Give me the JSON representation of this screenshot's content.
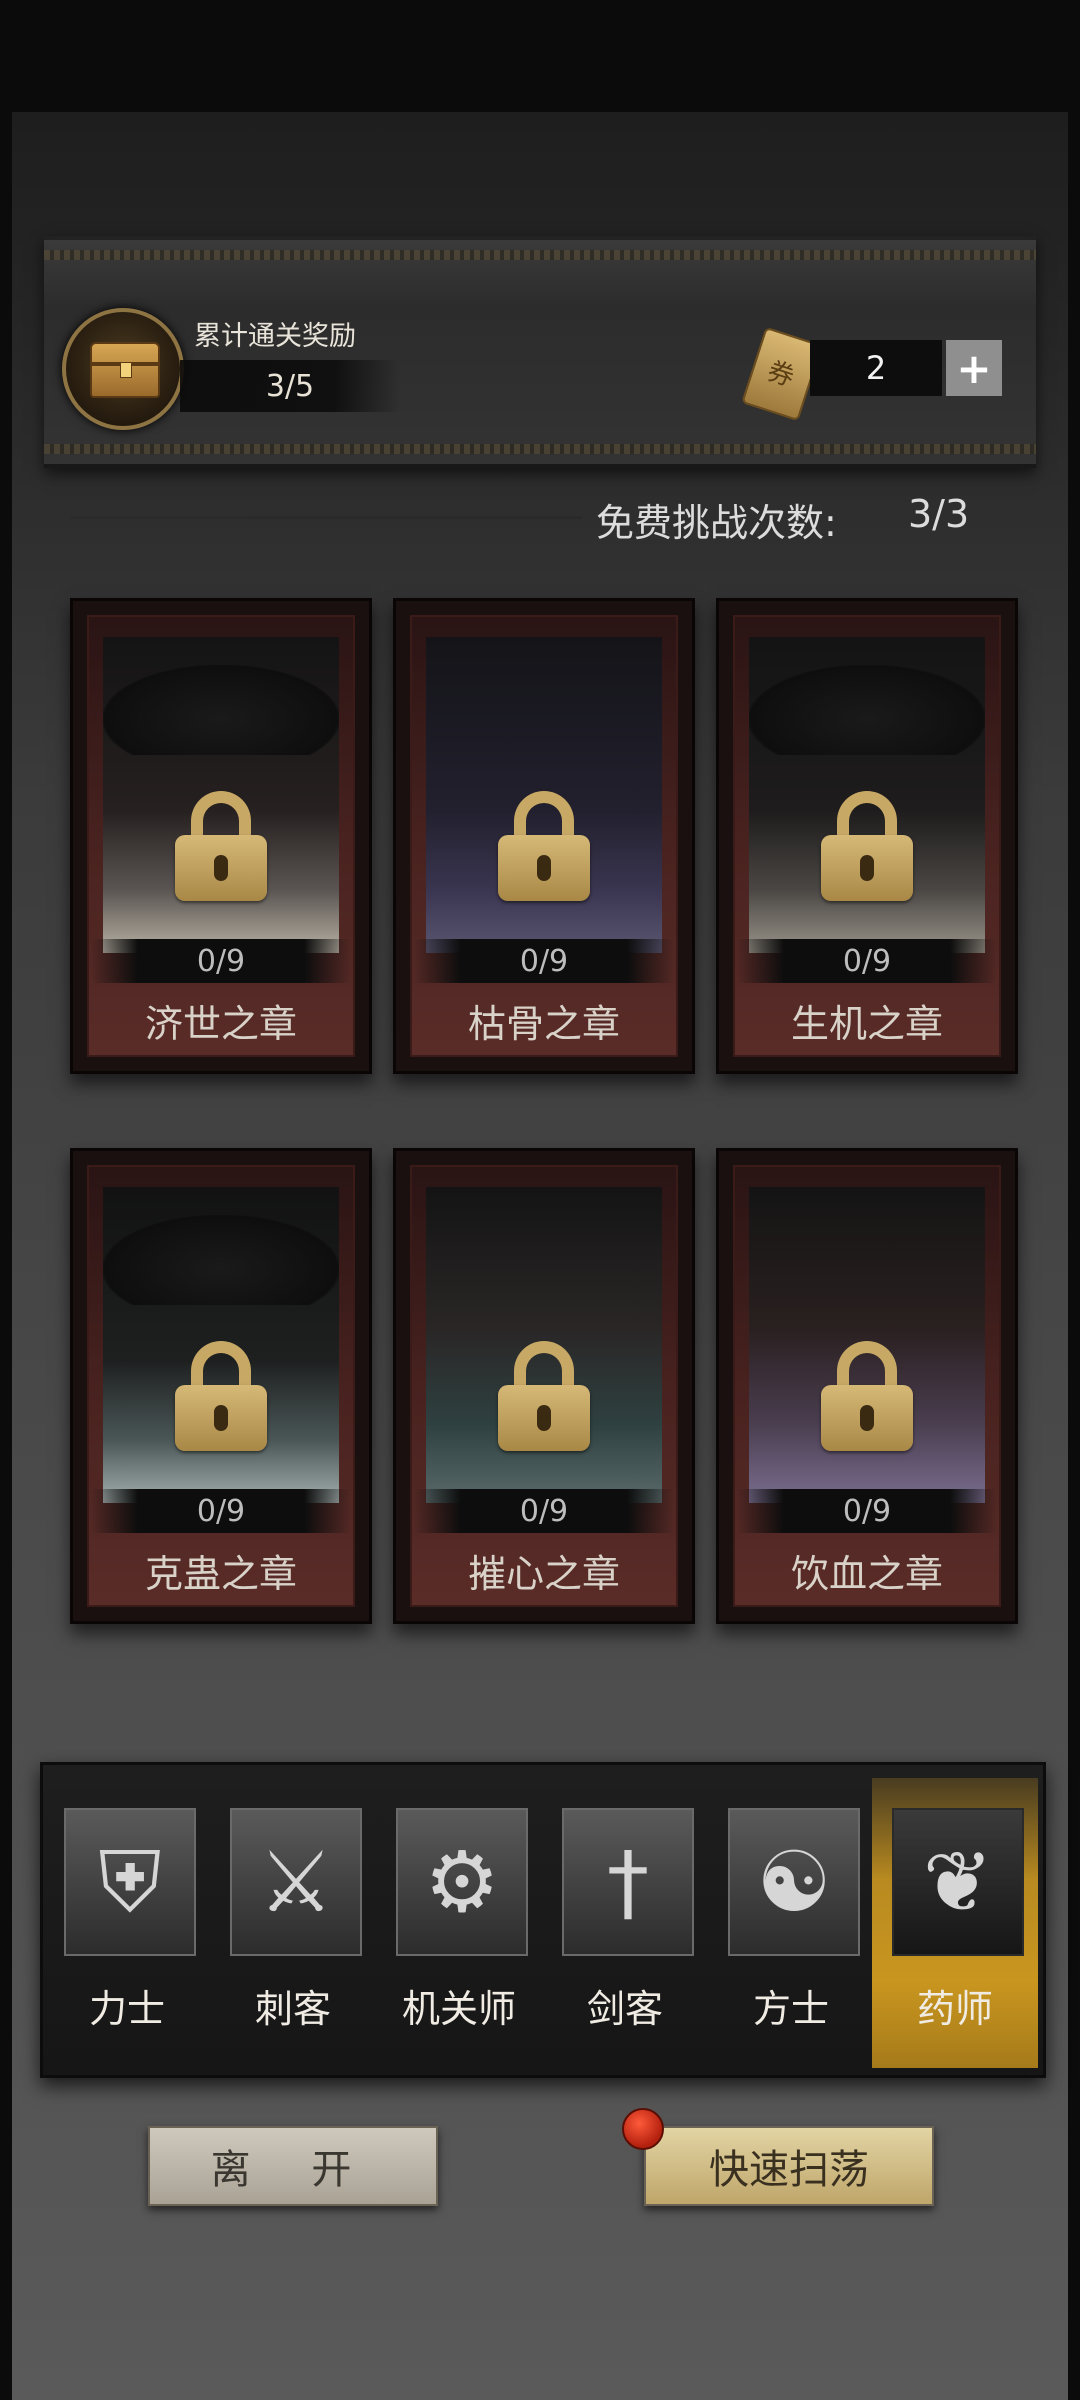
{
  "reward": {
    "title": "累计通关奖励",
    "progress": "3/5"
  },
  "ticket": {
    "glyph": "券",
    "count": "2",
    "plus_label": "+"
  },
  "free_challenge": {
    "label": "免费挑战次数:",
    "value": "3/3"
  },
  "chapters": [
    {
      "name": "济世之章",
      "progress": "0/9",
      "locked": true
    },
    {
      "name": "枯骨之章",
      "progress": "0/9",
      "locked": true
    },
    {
      "name": "生机之章",
      "progress": "0/9",
      "locked": true
    },
    {
      "name": "克蛊之章",
      "progress": "0/9",
      "locked": true
    },
    {
      "name": "摧心之章",
      "progress": "0/9",
      "locked": true
    },
    {
      "name": "饮血之章",
      "progress": "0/9",
      "locked": true
    }
  ],
  "classes": [
    {
      "label": "力士",
      "icon": "shield-eye-icon",
      "glyph": "⛨",
      "active": false
    },
    {
      "label": "刺客",
      "icon": "blade-icon",
      "glyph": "⚔",
      "active": false
    },
    {
      "label": "机关师",
      "icon": "gear-icon",
      "glyph": "⚙",
      "active": false
    },
    {
      "label": "剑客",
      "icon": "sword-icon",
      "glyph": "†",
      "active": false
    },
    {
      "label": "方士",
      "icon": "yin-yang-icon",
      "glyph": "☯",
      "active": false
    },
    {
      "label": "药师",
      "icon": "herb-cauldron-icon",
      "glyph": "❦",
      "active": true
    }
  ],
  "buttons": {
    "leave": "离 开",
    "sweep": "快速扫荡"
  },
  "colors": {
    "active_tab": "#c9961f",
    "lock": "#c7a865",
    "notification_dot": "#d2301a"
  }
}
